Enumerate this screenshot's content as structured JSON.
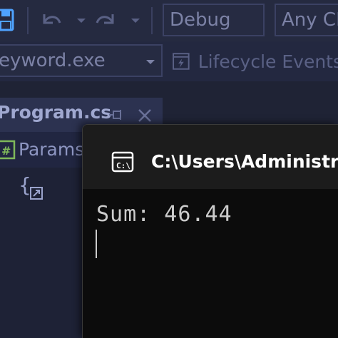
{
  "toolbar": {
    "configuration": "Debug",
    "platform": "Any CP",
    "startup_item": "eyword.exe",
    "lifecycle_label": "Lifecycle Events"
  },
  "editor": {
    "tab_title": "Program.cs",
    "navbar_label": "Params"
  },
  "console": {
    "title": "C:\\Users\\Administrato",
    "output_line": "Sum: 46.44"
  },
  "colors": {
    "vs_background": "#1f2335",
    "console_background": "#0c0c0c",
    "console_text": "#cccccc"
  }
}
